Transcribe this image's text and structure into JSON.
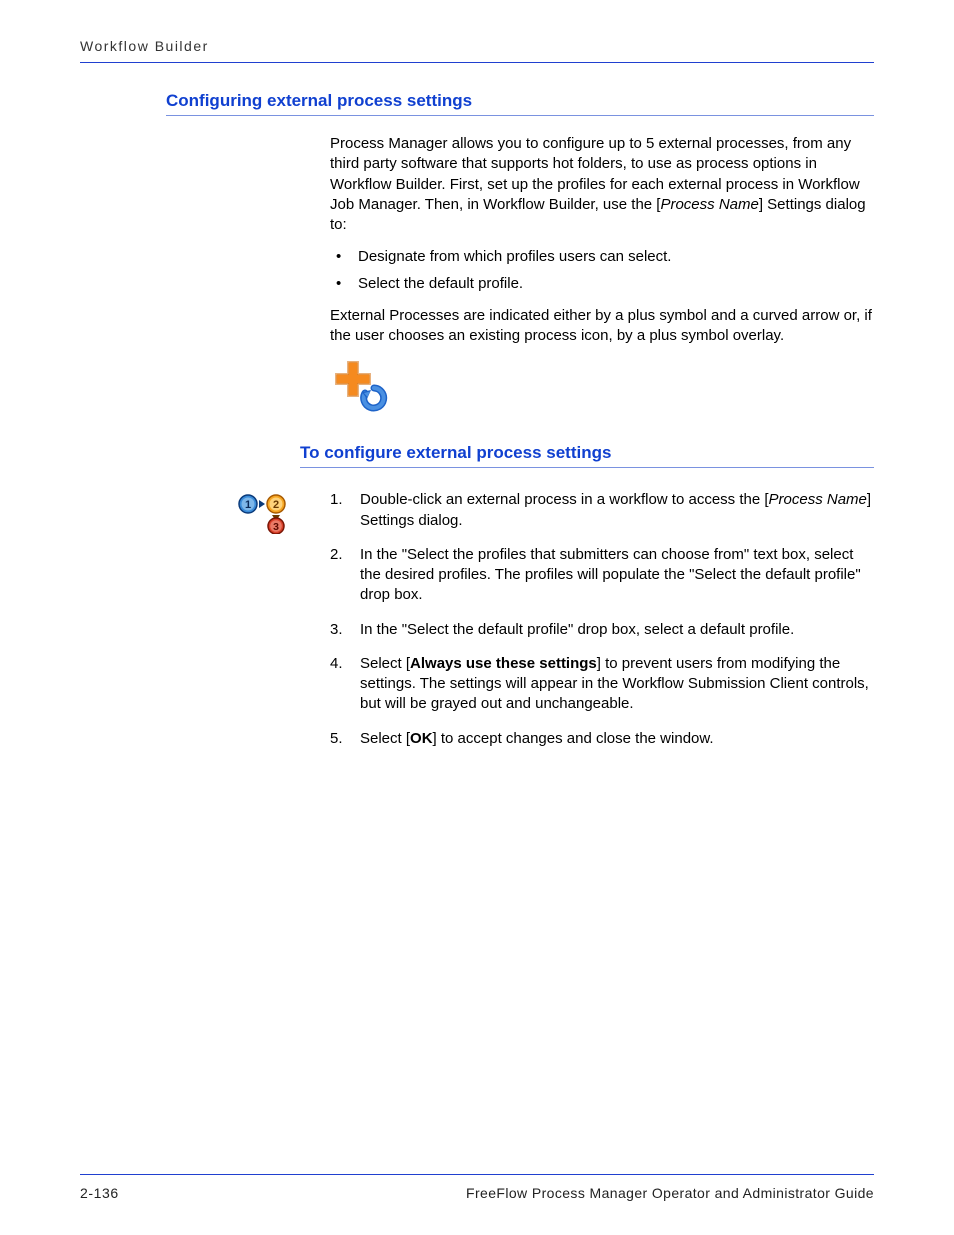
{
  "header": {
    "running_title": "Workflow Builder"
  },
  "section1": {
    "heading": "Configuring external process settings",
    "para1_a": "Process Manager allows you to configure up to 5 external processes, from any third party software that supports hot folders, to use as process options in Workflow Builder. First, set up the profiles for each external process in Workflow Job Manager. Then, in Workflow Builder, use the [",
    "para1_em": "Process Name",
    "para1_b": "] Settings dialog to:",
    "bullets": [
      "Designate from which profiles users can select.",
      "Select the default profile."
    ],
    "para2": "External Processes are indicated either by a plus symbol and a curved arrow or, if the user chooses an existing process icon, by a plus symbol overlay."
  },
  "section2": {
    "heading": "To configure external process settings",
    "steps": {
      "s1a": "Double-click an external process in a workflow to access the [",
      "s1em": "Process Name",
      "s1b": "] Settings dialog.",
      "s2": "In the \"Select the profiles that submitters can choose from\" text box, select the desired profiles. The profiles will populate the \"Select the default profile\" drop box.",
      "s3": "In the \"Select the default profile\" drop box, select a default profile.",
      "s4a": "Select [",
      "s4strong": "Always use these settings",
      "s4b": "] to prevent users from modifying the settings. The settings will appear in the Workflow Submission Client controls, but will be grayed out and unchangeable.",
      "s5a": "Select [",
      "s5strong": "OK",
      "s5b": "] to accept changes and close the window."
    }
  },
  "footer": {
    "page_number": "2-136",
    "book_title": "FreeFlow Process Manager Operator and Administrator Guide"
  }
}
